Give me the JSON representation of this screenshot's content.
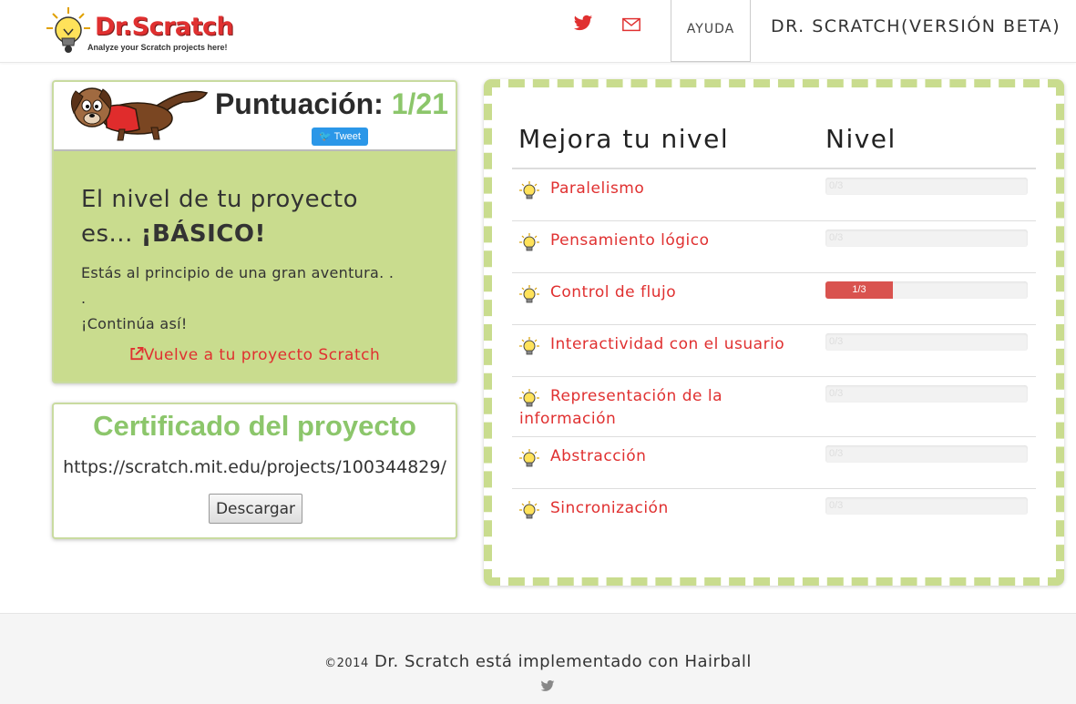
{
  "header": {
    "logo_text": "Dr.Scratch",
    "logo_tagline": "Analyze your Scratch projects here!",
    "twitter_icon": "twitter-icon",
    "mail_icon": "mail-icon",
    "help_label": "AYUDA",
    "brand_label": "DR. SCRATCH(VERSIÓN BETA)",
    "accent_color": "#e03030"
  },
  "score": {
    "title": "Puntuación:",
    "value": "1/21",
    "tweet_label": "Tweet",
    "level_line1": "El nivel de tu proyecto",
    "level_line2_prefix": "es... ",
    "level_name": "¡BÁSICO!",
    "message_line1": "Estás al principio de una gran aventura. .",
    "message_line2": ".",
    "message_line3": "¡Continúa así!",
    "back_link_label": "Vuelve a tu proyecto Scratch",
    "panel_color": "#c9dc8e"
  },
  "certificate": {
    "title": "Certificado del proyecto",
    "url": "https://scratch.mit.edu/projects/100344829/",
    "download_label": "Descargar",
    "title_color": "#8cc66b"
  },
  "skills": {
    "col_skill": "Mejora tu nivel",
    "col_level": "Nivel",
    "rows": [
      {
        "label": "Paralelismo",
        "score": "0/3",
        "fraction": 0
      },
      {
        "label": "Pensamiento lógico",
        "score": "0/3",
        "fraction": 0
      },
      {
        "label": "Control de flujo",
        "score": "1/3",
        "fraction": 0.333
      },
      {
        "label": "Interactividad con el usuario",
        "score": "0/3",
        "fraction": 0
      },
      {
        "label_line1": "Representación de la",
        "label_line2": "información",
        "score": "0/3",
        "fraction": 0
      },
      {
        "label": "Abstracción",
        "score": "0/3",
        "fraction": 0
      },
      {
        "label": "Sincronización",
        "score": "0/3",
        "fraction": 0
      }
    ],
    "bar_fill_color": "#d9534f"
  },
  "footer": {
    "copyright": "©2014",
    "text": "Dr. Scratch está implementado con Hairball",
    "twitter_icon": "twitter-icon"
  }
}
